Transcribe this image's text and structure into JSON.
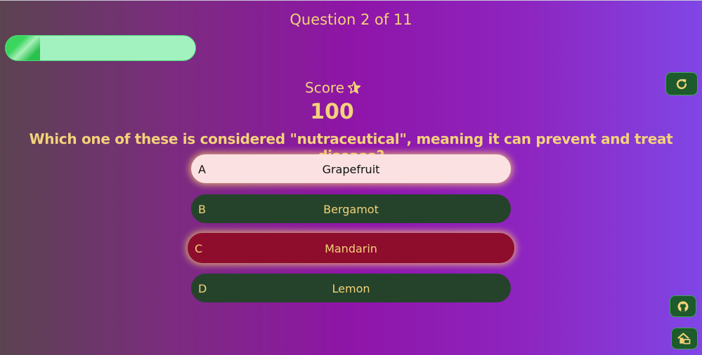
{
  "header": {
    "question_counter": "Question 2 of 11"
  },
  "progress": {
    "fraction": 0.18
  },
  "score": {
    "label": "Score",
    "value": "100",
    "icon": "star-icon"
  },
  "question": {
    "text": "Which one of these is considered \"nutraceutical\", meaning it can prevent and treat disease?"
  },
  "options": [
    {
      "letter": "A",
      "text": "Grapefruit"
    },
    {
      "letter": "B",
      "text": "Bergamot"
    },
    {
      "letter": "C",
      "text": "Mandarin"
    },
    {
      "letter": "D",
      "text": "Lemon"
    }
  ],
  "controls": {
    "restart_icon": "restart-icon",
    "github_icon": "github-icon",
    "home_icon": "home-icon"
  },
  "colors": {
    "text_gold": "#f3d27a",
    "option_default": "#24432a",
    "option_selected": "#fbe1e2",
    "option_wrong": "#8e0c2c",
    "progress_track": "#a2f2c0"
  }
}
